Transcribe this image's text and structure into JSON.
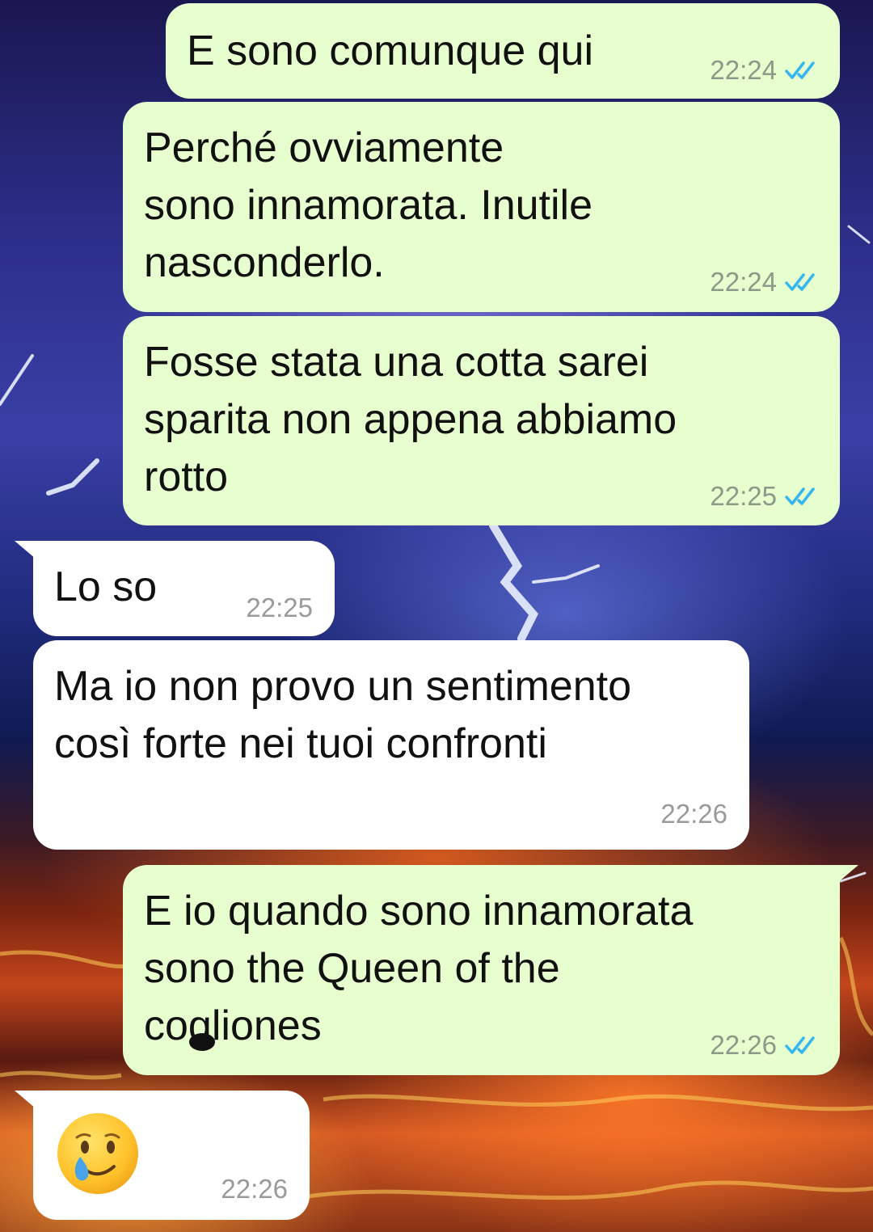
{
  "colors": {
    "outgoing_bubble": "#e7fecf",
    "incoming_bubble": "#ffffff",
    "read_ticks": "#34b7f1",
    "timestamp": "#8a9a8a"
  },
  "messages": [
    {
      "direction": "outgoing",
      "text": "E sono comunque qui",
      "time": "22:24",
      "status": "read"
    },
    {
      "direction": "outgoing",
      "text": "Perché ovviamente\nsono innamorata. Inutile\nnasconderlo.",
      "time": "22:24",
      "status": "read"
    },
    {
      "direction": "outgoing",
      "text": "Fosse stata una cotta sarei\nsparita non appena abbiamo\nrotto",
      "time": "22:25",
      "status": "read"
    },
    {
      "direction": "incoming",
      "text": "Lo so",
      "time": "22:25"
    },
    {
      "direction": "incoming",
      "text": "Ma io non provo un sentimento\ncosì forte nei tuoi confronti",
      "time": "22:26"
    },
    {
      "direction": "outgoing",
      "text": "E io quando sono innamorata\nsono the Queen of the\ncogliones",
      "time": "22:26",
      "status": "read"
    },
    {
      "direction": "incoming",
      "emoji": "face-holding-back-tears",
      "time": "22:26"
    }
  ]
}
